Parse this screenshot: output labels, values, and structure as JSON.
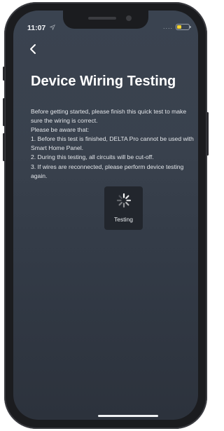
{
  "status_bar": {
    "time": "11:07",
    "signal": "....",
    "battery_level": 0.35,
    "battery_color": "#f6d431"
  },
  "nav": {
    "back_icon": "chevron-left-icon"
  },
  "page": {
    "title": "Device Wiring Testing",
    "intro": "Before getting started, please finish this quick test to make sure the wiring is correct.",
    "notice_heading": "Please be aware that:",
    "items": [
      "1. Before this test is finished, DELTA Pro cannot be used with Smart Home Panel.",
      "2. During this testing, all circuits will be cut-off.",
      "3. If wires are reconnected, please perform device testing again."
    ]
  },
  "loading": {
    "label": "Testing",
    "icon": "spinner-icon"
  },
  "colors": {
    "background_top": "#3a4350",
    "background_bottom": "#2c323c",
    "text": "#ffffff"
  }
}
